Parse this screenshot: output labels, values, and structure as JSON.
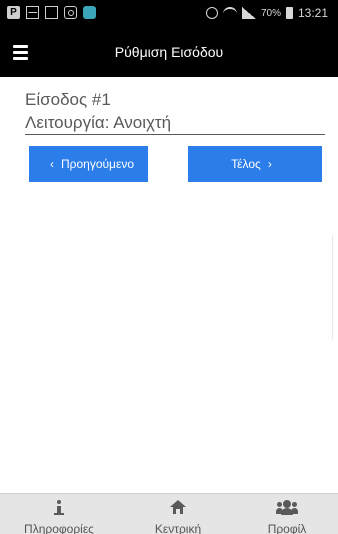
{
  "status_bar": {
    "battery_percent": "70%",
    "time": "13:21",
    "icons_left": [
      "p-icon",
      "mail-icon",
      "image-icon",
      "instagram-icon",
      "app-icon"
    ],
    "icons_right": [
      "alarm-icon",
      "wifi-icon",
      "signal-icon",
      "battery-icon"
    ]
  },
  "app_bar": {
    "title": "Ρύθμιση Εισόδου",
    "menu_icon": "hamburger-menu-icon"
  },
  "entry": {
    "title": "Είσοδος #1",
    "mode": "Λειτουργία: Ανοιχτή"
  },
  "buttons": {
    "prev_label": "Προηγούμενο",
    "next_label": "Τέλος",
    "prev_chevron": "‹",
    "next_chevron": "›"
  },
  "colors": {
    "primary_button": "#2b7de9",
    "app_bar": "#000000",
    "bottom_nav": "#e5e5e5"
  },
  "bottom_nav": {
    "items": [
      {
        "label": "Πληροφορίες",
        "icon": "info-icon"
      },
      {
        "label": "Κεντρική",
        "icon": "home-icon"
      },
      {
        "label": "Προφίλ",
        "icon": "users-icon"
      }
    ]
  }
}
